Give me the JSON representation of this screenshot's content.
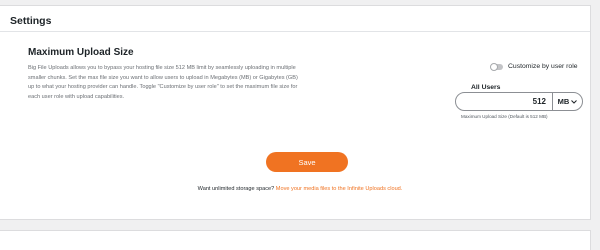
{
  "panel": {
    "title": "Settings"
  },
  "section": {
    "title": "Maximum Upload Size",
    "description": "Big File Uploads allows you to bypass your hosting file size 512 MB limit by seamlessly uploading in multiple smaller chunks. Set the max file size you want to allow users to upload in Megabytes (MB) or Gigabytes (GB) up to what your hosting provider can handle. Toggle \"Customize by user role\" to set the maximum file size for each user role with upload capabilities."
  },
  "toggle": {
    "label": "Customize by user role",
    "on": false
  },
  "all_users": {
    "label": "All Users",
    "value": "512",
    "unit": "MB",
    "helper": "Maximum Upload Size (Default is 512 MB)"
  },
  "actions": {
    "save_label": "Save"
  },
  "promo": {
    "text": "Want unlimited storage space?",
    "link_text": "Move your media files to the Infinite Uploads cloud."
  },
  "colors": {
    "accent": "#f07322",
    "background": "#f0f0f1"
  },
  "icons": {
    "unit_dropdown": "chevron-down-icon"
  }
}
